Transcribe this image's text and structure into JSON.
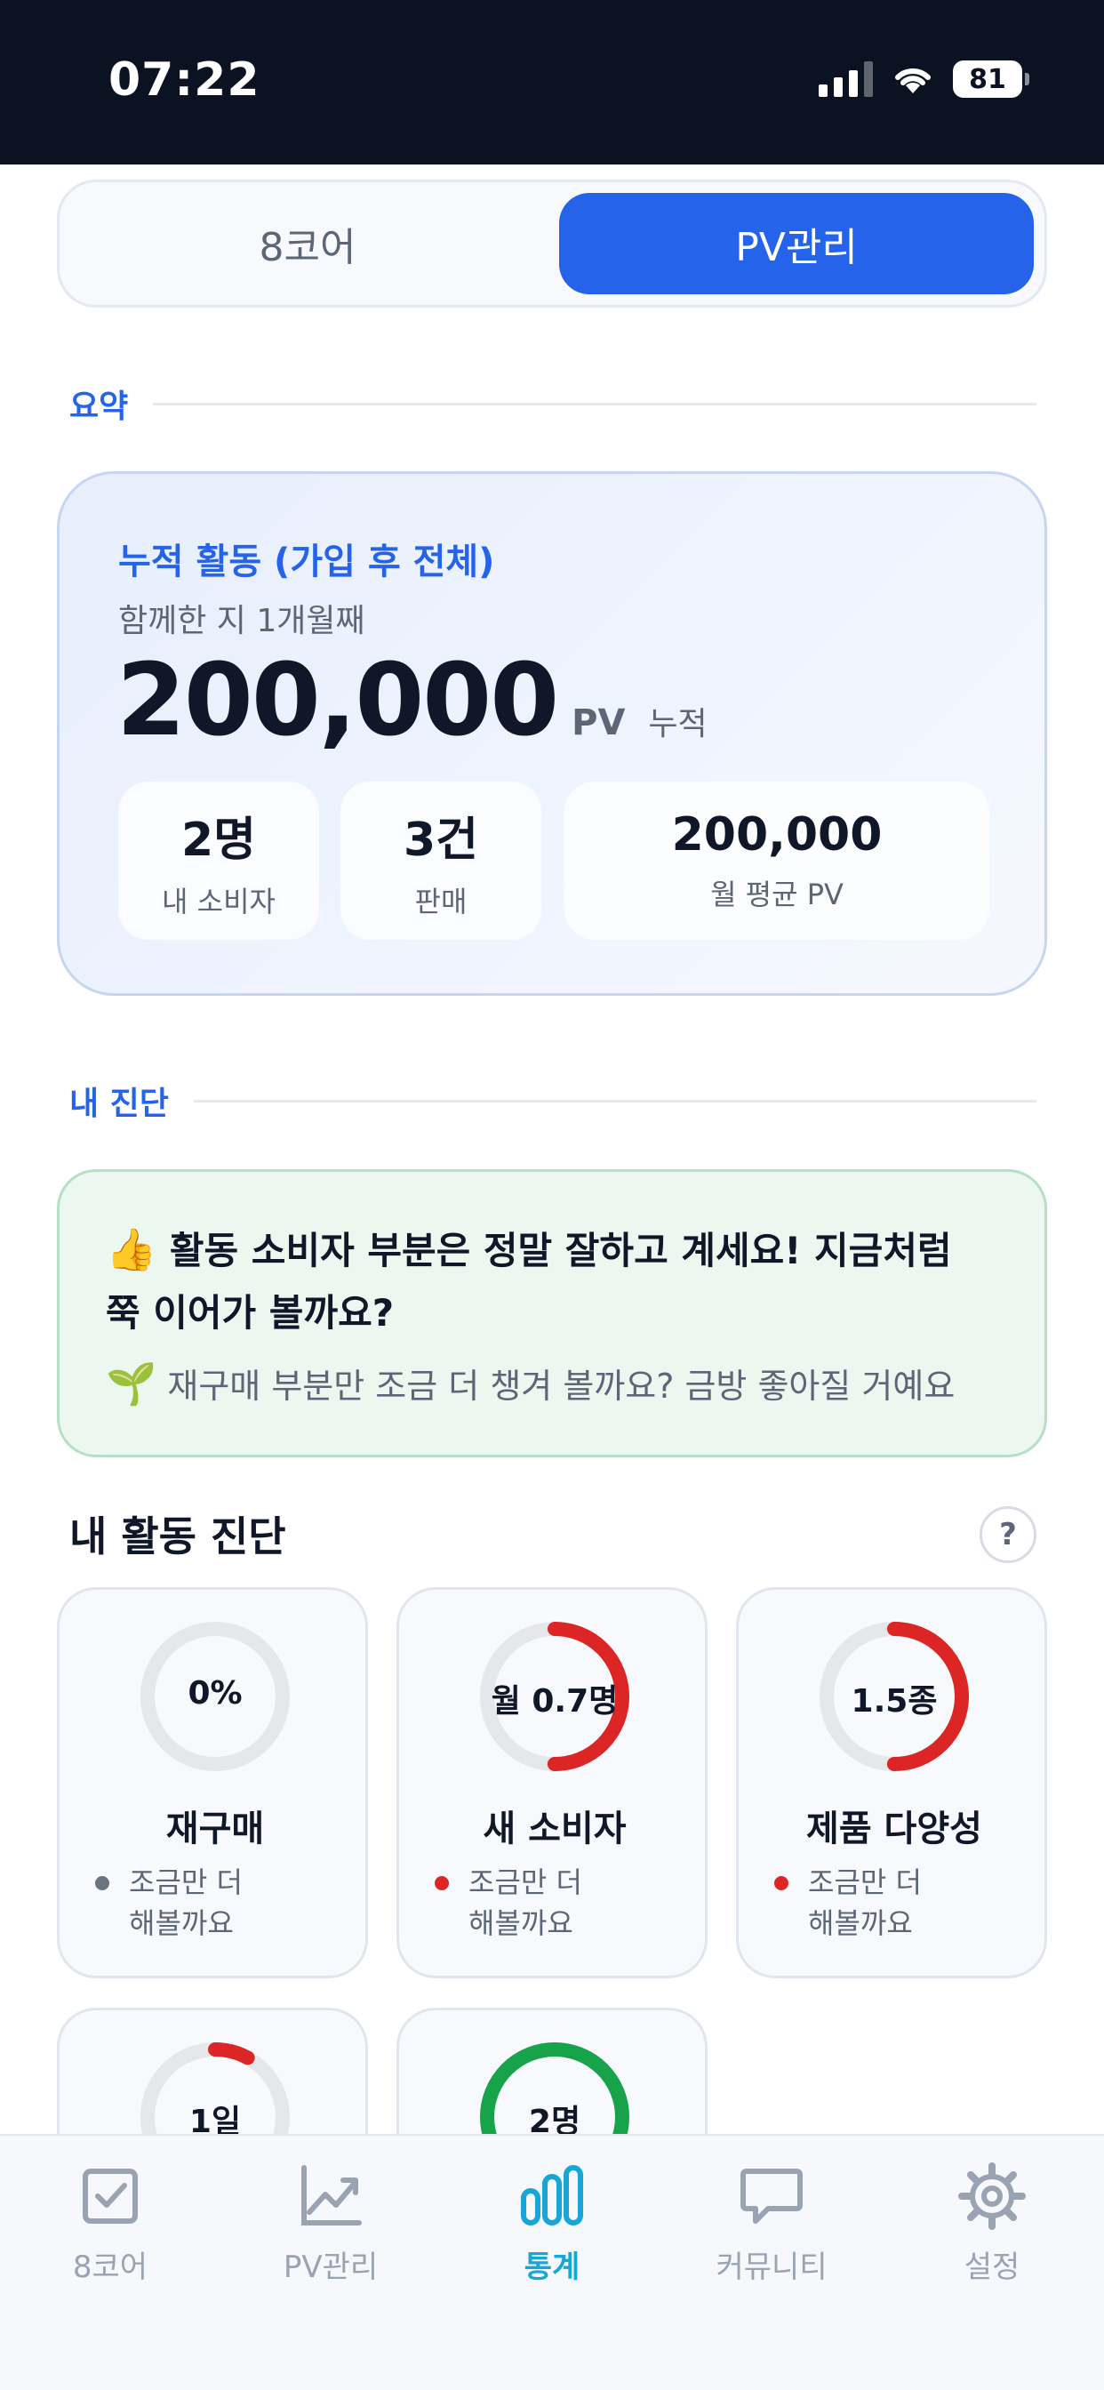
{
  "status_bar": {
    "time": "07:22",
    "battery": "81"
  },
  "tabs": {
    "left": "8코어",
    "right": "PV관리",
    "active": "right"
  },
  "summary_section": {
    "label": "요약",
    "card": {
      "title": "누적 활동 (가입 후 전체)",
      "subtitle": "함께한 지 1개월째",
      "total": "200,000",
      "unit": "PV",
      "tag": "누적",
      "stats": [
        {
          "value": "2명",
          "label": "내 소비자"
        },
        {
          "value": "3건",
          "label": "판매"
        },
        {
          "value": "200,000",
          "label": "월 평균 PV"
        }
      ]
    }
  },
  "diagnosis_section": {
    "label": "내 진단",
    "praise_emoji": "👍",
    "praise": "활동 소비자 부분은 정말 잘하고 계세요! 지금처럼 쭉 이어가 볼까요?",
    "tip_emoji": "🌱",
    "tip": "재구매 부분만 조금 더 챙겨 볼까요? 금방 좋아질 거예요"
  },
  "activity": {
    "title": "내 활동 진단",
    "help": "?",
    "tiles": [
      {
        "value": "0%",
        "progress": 0,
        "title": "재구매",
        "status": "조금만 더\n해볼까요",
        "status_color": "#6b7280",
        "ring_color": "#dc2626"
      },
      {
        "value": "월 0.7명",
        "progress": 0.5,
        "title": "새 소비자",
        "status": "조금만 더\n해볼까요",
        "status_color": "#dc2626",
        "ring_color": "#dc2626"
      },
      {
        "value": "1.5종",
        "progress": 0.5,
        "title": "제품 다양성",
        "status": "조금만 더\n해볼까요",
        "status_color": "#dc2626",
        "ring_color": "#dc2626"
      },
      {
        "value": "1일",
        "progress": 0.08,
        "title": "",
        "status": "",
        "status_color": "#dc2626",
        "ring_color": "#dc2626"
      },
      {
        "value": "2명",
        "progress": 1,
        "title": "",
        "status": "",
        "status_color": "#16a34a",
        "ring_color": "#16a34a"
      }
    ]
  },
  "bottom_nav": {
    "items": [
      {
        "label": "8코어",
        "icon": "checkbox-icon"
      },
      {
        "label": "PV관리",
        "icon": "trend-chart-icon"
      },
      {
        "label": "통계",
        "icon": "bar-stats-icon"
      },
      {
        "label": "커뮤니티",
        "icon": "chat-bubble-icon"
      },
      {
        "label": "설정",
        "icon": "gear-icon"
      }
    ],
    "active_index": 2
  },
  "colors": {
    "primary": "#2563eb",
    "active_nav": "#16a6d8",
    "danger": "#dc2626",
    "success": "#16a34a"
  }
}
